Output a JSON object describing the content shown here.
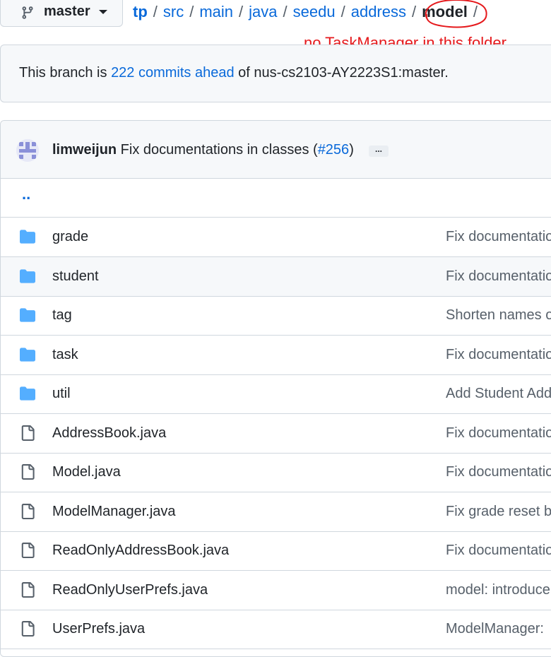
{
  "branch": {
    "name": "master",
    "icon": "git-branch-icon"
  },
  "breadcrumb": {
    "root": "tp",
    "segments": [
      "src",
      "main",
      "java",
      "seedu",
      "address"
    ],
    "current": "model",
    "trailing": "/"
  },
  "annotation": {
    "text": "no TaskManager in this folder",
    "color": "#e5191c"
  },
  "ahead_banner": {
    "prefix": "This branch is ",
    "link": "222 commits ahead",
    "suffix": " of nus-cs2103-AY2223S1:master."
  },
  "latest_commit": {
    "author": "limweijun",
    "message": " Fix documentations in classes (",
    "pr": "#256",
    "close": ")",
    "more": "..."
  },
  "parent_dir": "..",
  "files": [
    {
      "type": "folder",
      "icon": "folder-icon",
      "name": "grade",
      "message": "Fix documentatio"
    },
    {
      "type": "folder",
      "icon": "folder-icon",
      "name": "student",
      "message": "Fix documentatio"
    },
    {
      "type": "folder",
      "icon": "folder-icon",
      "name": "tag",
      "message": "Shorten names o"
    },
    {
      "type": "folder",
      "icon": "folder-icon",
      "name": "task",
      "message": "Fix documentatio"
    },
    {
      "type": "folder",
      "icon": "folder-icon",
      "name": "util",
      "message": "Add Student Add"
    },
    {
      "type": "file",
      "icon": "file-icon",
      "name": "AddressBook.java",
      "message": "Fix documentatio"
    },
    {
      "type": "file",
      "icon": "file-icon",
      "name": "Model.java",
      "message": "Fix documentatio"
    },
    {
      "type": "file",
      "icon": "file-icon",
      "name": "ModelManager.java",
      "message": "Fix grade reset b"
    },
    {
      "type": "file",
      "icon": "file-icon",
      "name": "ReadOnlyAddressBook.java",
      "message": "Fix documentatio"
    },
    {
      "type": "file",
      "icon": "file-icon",
      "name": "ReadOnlyUserPrefs.java",
      "message": "model: introduce"
    },
    {
      "type": "file",
      "icon": "file-icon",
      "name": "UserPrefs.java",
      "message": "ModelManager: "
    }
  ],
  "colors": {
    "link": "#0969da",
    "folder": "#54aeff",
    "border": "#d0d7de",
    "muted": "#57606a"
  }
}
